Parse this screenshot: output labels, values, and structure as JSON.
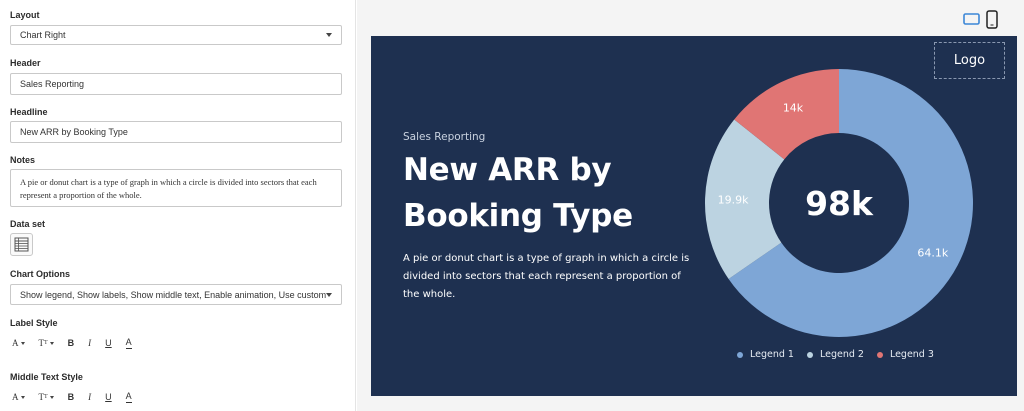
{
  "settings": {
    "layout": {
      "label": "Layout",
      "value": "Chart Right"
    },
    "header": {
      "label": "Header",
      "value": "Sales Reporting"
    },
    "headline": {
      "label": "Headline",
      "value": "New ARR by Booking Type"
    },
    "notes": {
      "label": "Notes",
      "value": "A pie or donut chart is a type of graph in which a circle is divided into sectors that each represent a proportion of the whole."
    },
    "dataset": {
      "label": "Data set",
      "icon": "table-icon"
    },
    "chart_options": {
      "label": "Chart Options",
      "value": "Show legend, Show labels, Show middle text, Enable animation, Use custom c"
    },
    "label_style": {
      "label": "Label Style"
    },
    "middle_text_style": {
      "label": "Middle Text Style"
    },
    "toolbar": {
      "font": "A",
      "size": "T",
      "bold": "B",
      "italic": "I",
      "underline": "U",
      "color": "A"
    }
  },
  "preview": {
    "logo": "Logo",
    "header": "Sales Reporting",
    "headline": "New ARR by Booking Type",
    "notes": "A pie or donut chart is a type of graph in which a circle is divided into sectors that each represent a proportion of the whole.",
    "middle_text": "98k",
    "device_icons": [
      "desktop-icon",
      "mobile-icon"
    ],
    "background_color": "#1e3050"
  },
  "chart_data": {
    "type": "pie",
    "variant": "donut",
    "categories": [
      "Legend 1",
      "Legend 2",
      "Legend 3"
    ],
    "values": [
      64.1,
      19.9,
      14
    ],
    "data_labels": [
      "64.1k",
      "19.9k",
      "14k"
    ],
    "colors": [
      "#7ea6d6",
      "#bcd3e1",
      "#e07574"
    ],
    "center_text": "98k",
    "legend_position": "bottom",
    "title": ""
  }
}
